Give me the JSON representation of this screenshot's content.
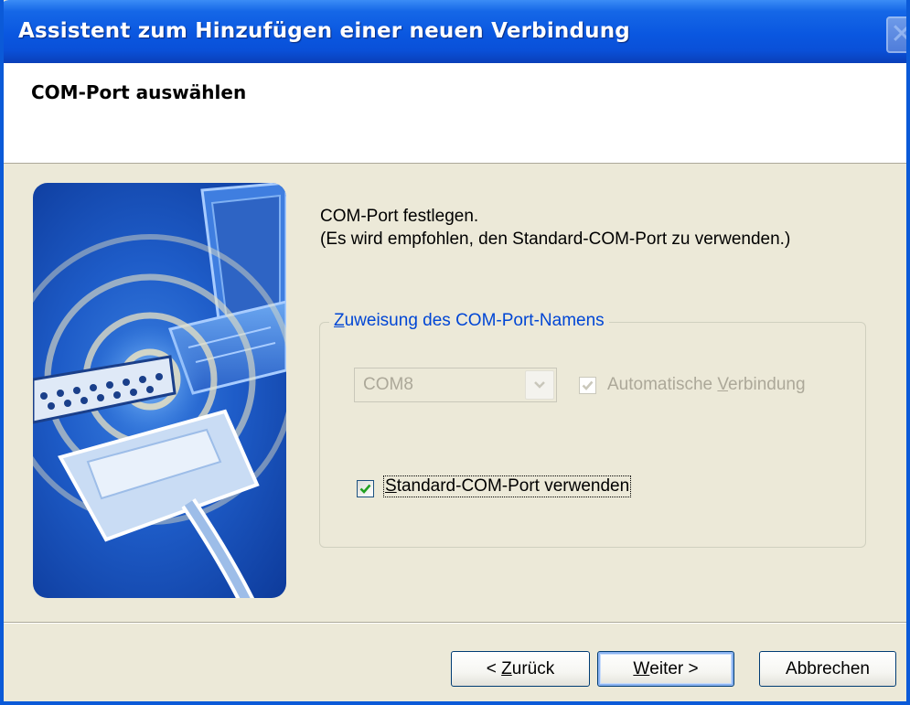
{
  "window": {
    "title": "Assistent zum Hinzufügen einer neuen Verbindung",
    "close_glyph": "✕"
  },
  "header": {
    "title": "COM-Port auswählen"
  },
  "content": {
    "line1": "COM-Port festlegen.",
    "line2": "(Es wird empfohlen, den Standard-COM-Port zu verwenden.)"
  },
  "group": {
    "legend_accel": "Z",
    "legend_rest": "uweisung des COM-Port-Namens",
    "port_select": {
      "value": "COM8",
      "disabled": true
    },
    "auto_connect": {
      "label_before": "Automatische ",
      "label_accel": "V",
      "label_after": "erbindung",
      "checked": true,
      "disabled": true
    },
    "use_default": {
      "label_accel": "S",
      "label_rest": "tandard-COM-Port verwenden",
      "checked": true
    }
  },
  "buttons": {
    "back_prefix": "< ",
    "back_accel": "Z",
    "back_rest": "urück",
    "next_accel": "W",
    "next_rest": "eiter >",
    "cancel": "Abbrechen"
  },
  "colors": {
    "titlebar": "#0a57e0",
    "dialog_bg": "#ece9d8",
    "legend_text": "#0046d5",
    "checkmark": "#21a121",
    "disabled_text": "#aca899"
  },
  "icons": {
    "banner": "wireless-serial-connection-illustration",
    "checkmark": "check-icon",
    "dropdown": "chevron-down-icon",
    "close": "close-icon"
  }
}
